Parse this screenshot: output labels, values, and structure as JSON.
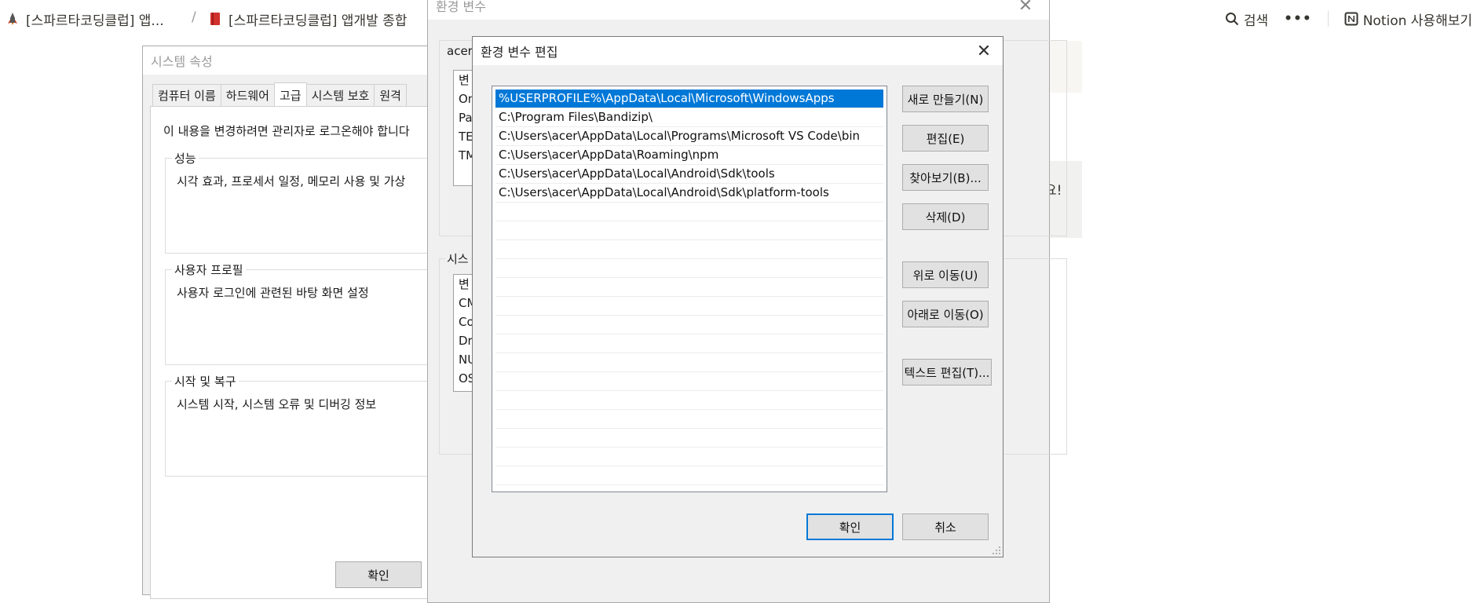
{
  "notion": {
    "breadcrumb1": "[스파르타코딩클럽] 앱...",
    "separator": "/",
    "breadcrumb2": "[스파르타코딩클럽] 앱개발 종합",
    "search_label": "검색",
    "more_label": "•••",
    "try_notion_label": "Notion 사용해보기",
    "right_fragment": "요!"
  },
  "system_properties": {
    "title": "시스템 속성",
    "tabs": [
      {
        "label": "컴퓨터 이름"
      },
      {
        "label": "하드웨어"
      },
      {
        "label": "고급"
      },
      {
        "label": "시스템 보호"
      },
      {
        "label": "원격"
      }
    ],
    "notice": "이 내용을 변경하려면 관리자로 로그온해야 합니다",
    "groups": [
      {
        "legend": "성능",
        "text": "시각 효과, 프로세서 일정, 메모리 사용 및 가상"
      },
      {
        "legend": "사용자 프로필",
        "text": "사용자 로그인에 관련된 바탕 화면 설정"
      },
      {
        "legend": "시작 및 복구",
        "text": "시스템 시작, 시스템 오류 및 디버깅 정보"
      }
    ],
    "ok_label": "확인"
  },
  "env_vars": {
    "title": "환경 변수",
    "user_section_label": "acer",
    "system_section_label": "시스",
    "user_list_fragments": [
      "변",
      "On",
      "Pa",
      "TE",
      "TM"
    ],
    "system_list_fragments": [
      "변",
      "CM",
      "Co",
      "Dr",
      "NU",
      "OS"
    ]
  },
  "edit_env_var": {
    "title": "환경 변수 편집",
    "paths": [
      "%USERPROFILE%\\AppData\\Local\\Microsoft\\WindowsApps",
      "C:\\Program Files\\Bandizip\\",
      "C:\\Users\\acer\\AppData\\Local\\Programs\\Microsoft VS Code\\bin",
      "C:\\Users\\acer\\AppData\\Roaming\\npm",
      "C:\\Users\\acer\\AppData\\Local\\Android\\Sdk\\tools",
      "C:\\Users\\acer\\AppData\\Local\\Android\\Sdk\\platform-tools"
    ],
    "selected_index": 0,
    "buttons": {
      "new": "새로 만들기(N)",
      "edit": "편집(E)",
      "browse": "찾아보기(B)...",
      "delete": "삭제(D)",
      "move_up": "위로 이동(U)",
      "move_down": "아래로 이동(O)",
      "edit_text": "텍스트 편집(T)...",
      "ok": "확인",
      "cancel": "취소"
    },
    "accent_color": "#0078d7"
  }
}
